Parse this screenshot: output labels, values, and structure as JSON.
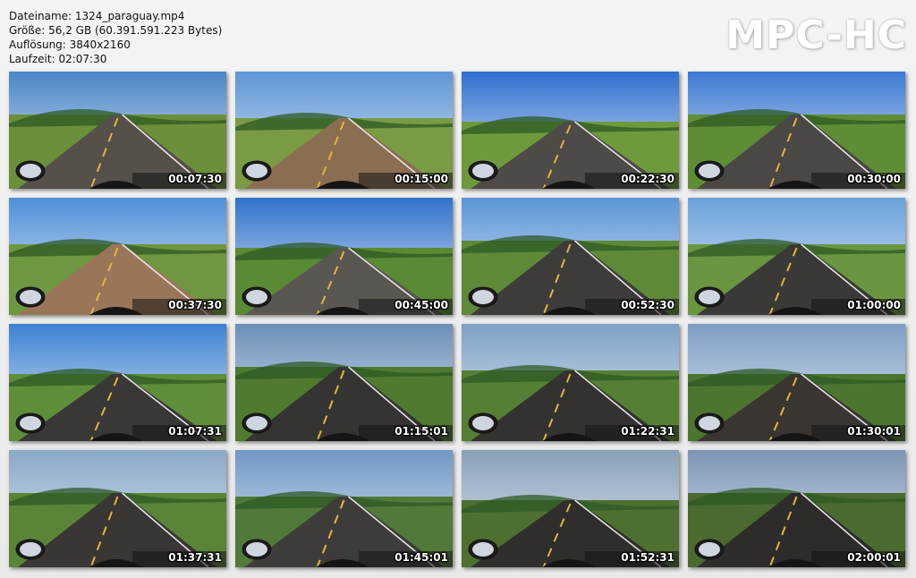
{
  "info": {
    "filename": "Dateiname: 1324_paraguay.mp4",
    "size": "Größe: 56,2 GB (60.391.591.223 Bytes)",
    "resolution": "Auflösung: 3840x2160",
    "duration": "Laufzeit: 02:07:30"
  },
  "brand": "MPC-HC",
  "thumbnails": [
    {
      "time": "00:07:30",
      "sky": "#4a86c8",
      "ground": "#6b8f3a",
      "road": "#55504a"
    },
    {
      "time": "00:15:00",
      "sky": "#5d95d6",
      "ground": "#7a9a44",
      "road": "#8a6e52"
    },
    {
      "time": "00:22:30",
      "sky": "#2f6fd0",
      "ground": "#6e9a3c",
      "road": "#4e4a47"
    },
    {
      "time": "00:30:00",
      "sky": "#3b79d2",
      "ground": "#5f8d36",
      "road": "#4a4744"
    },
    {
      "time": "00:37:30",
      "sky": "#4f8fd8",
      "ground": "#6f9640",
      "road": "#9a7658"
    },
    {
      "time": "00:45:00",
      "sky": "#2f72cc",
      "ground": "#5b8a34",
      "road": "#5a5753"
    },
    {
      "time": "00:52:30",
      "sky": "#5b95d8",
      "ground": "#5e8a38",
      "road": "#3e3c3a"
    },
    {
      "time": "01:00:00",
      "sky": "#6aa0dc",
      "ground": "#6a9642",
      "road": "#3b3937"
    },
    {
      "time": "01:07:31",
      "sky": "#3d82d4",
      "ground": "#5f8e3a",
      "road": "#3a3836"
    },
    {
      "time": "01:15:01",
      "sky": "#6b8fb8",
      "ground": "#4f7a30",
      "road": "#363432"
    },
    {
      "time": "01:22:31",
      "sky": "#7ea1c6",
      "ground": "#557f34",
      "road": "#343230"
    },
    {
      "time": "01:30:01",
      "sky": "#7f9ec4",
      "ground": "#4c7630",
      "road": "#3b3532"
    },
    {
      "time": "01:37:31",
      "sky": "#8aa8c8",
      "ground": "#5a8438",
      "road": "#3a3634"
    },
    {
      "time": "01:45:01",
      "sky": "#6f98c6",
      "ground": "#51793a",
      "road": "#3e3c3b"
    },
    {
      "time": "01:52:31",
      "sky": "#8aa0b8",
      "ground": "#4d6f30",
      "road": "#2f2e2d"
    },
    {
      "time": "02:00:01",
      "sky": "#7d94b4",
      "ground": "#4a6a2f",
      "road": "#2d2c2b"
    }
  ]
}
